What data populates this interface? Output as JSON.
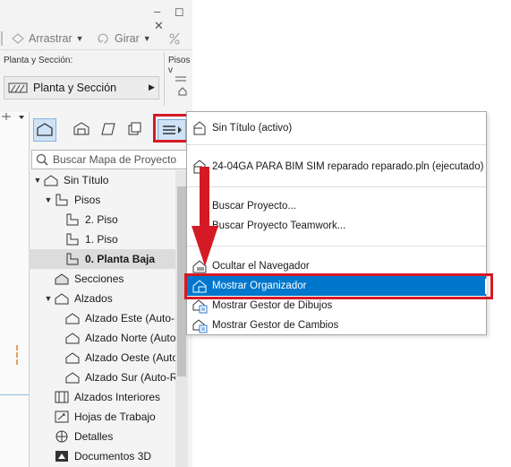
{
  "toolbar": {
    "arrastrar": "Arrastrar",
    "girar": "Girar",
    "section_label": "Planta y Sección:",
    "pisos_label": "Pisos v",
    "planta_value": "Planta y Sección"
  },
  "navigator": {
    "search_placeholder": "Buscar Mapa de Proyecto",
    "tree": [
      {
        "label": "Sin Título",
        "icon": "project-icon"
      },
      {
        "label": "Pisos",
        "icon": "folder-floors-icon"
      },
      {
        "label": "2. Piso",
        "icon": "floor-icon"
      },
      {
        "label": "1. Piso",
        "icon": "floor-icon"
      },
      {
        "label": "0. Planta Baja",
        "icon": "floor-icon",
        "selected": true
      },
      {
        "label": "Secciones",
        "icon": "section-icon"
      },
      {
        "label": "Alzados",
        "icon": "elevation-folder-icon"
      },
      {
        "label": "Alzado Este (Auto-R",
        "icon": "elevation-icon"
      },
      {
        "label": "Alzado Norte (Auto",
        "icon": "elevation-icon"
      },
      {
        "label": "Alzado Oeste (Auto-",
        "icon": "elevation-icon"
      },
      {
        "label": "Alzado Sur (Auto-R",
        "icon": "elevation-icon"
      },
      {
        "label": "Alzados Interiores",
        "icon": "interior-elevation-icon"
      },
      {
        "label": "Hojas de Trabajo",
        "icon": "worksheet-icon"
      },
      {
        "label": "Detalles",
        "icon": "detail-icon"
      },
      {
        "label": "Documentos 3D",
        "icon": "document-3d-icon"
      }
    ]
  },
  "menu": {
    "items": [
      {
        "label": "Sin Título (activo)",
        "icon": "project-file-icon"
      },
      {
        "label": "24-04GA   PARA BIM SIM reparado reparado.pln (ejecutado)",
        "icon": "project-file-icon"
      },
      {
        "label": "Buscar Proyecto...",
        "icon": ""
      },
      {
        "label": "Buscar Proyecto Teamwork...",
        "icon": ""
      },
      {
        "label": "Ocultar el Navegador",
        "icon": "navigator-icon"
      },
      {
        "label": "Mostrar Organizador",
        "icon": "organizer-icon",
        "highlighted": true
      },
      {
        "label": "Mostrar Gestor de Dibujos",
        "icon": "drawing-manager-icon"
      },
      {
        "label": "Mostrar Gestor de Cambios",
        "icon": "change-manager-icon"
      }
    ]
  },
  "colors": {
    "highlight": "#0077cc",
    "annotation_red": "#d51a25",
    "selected_tab": "#cfe3f6"
  }
}
